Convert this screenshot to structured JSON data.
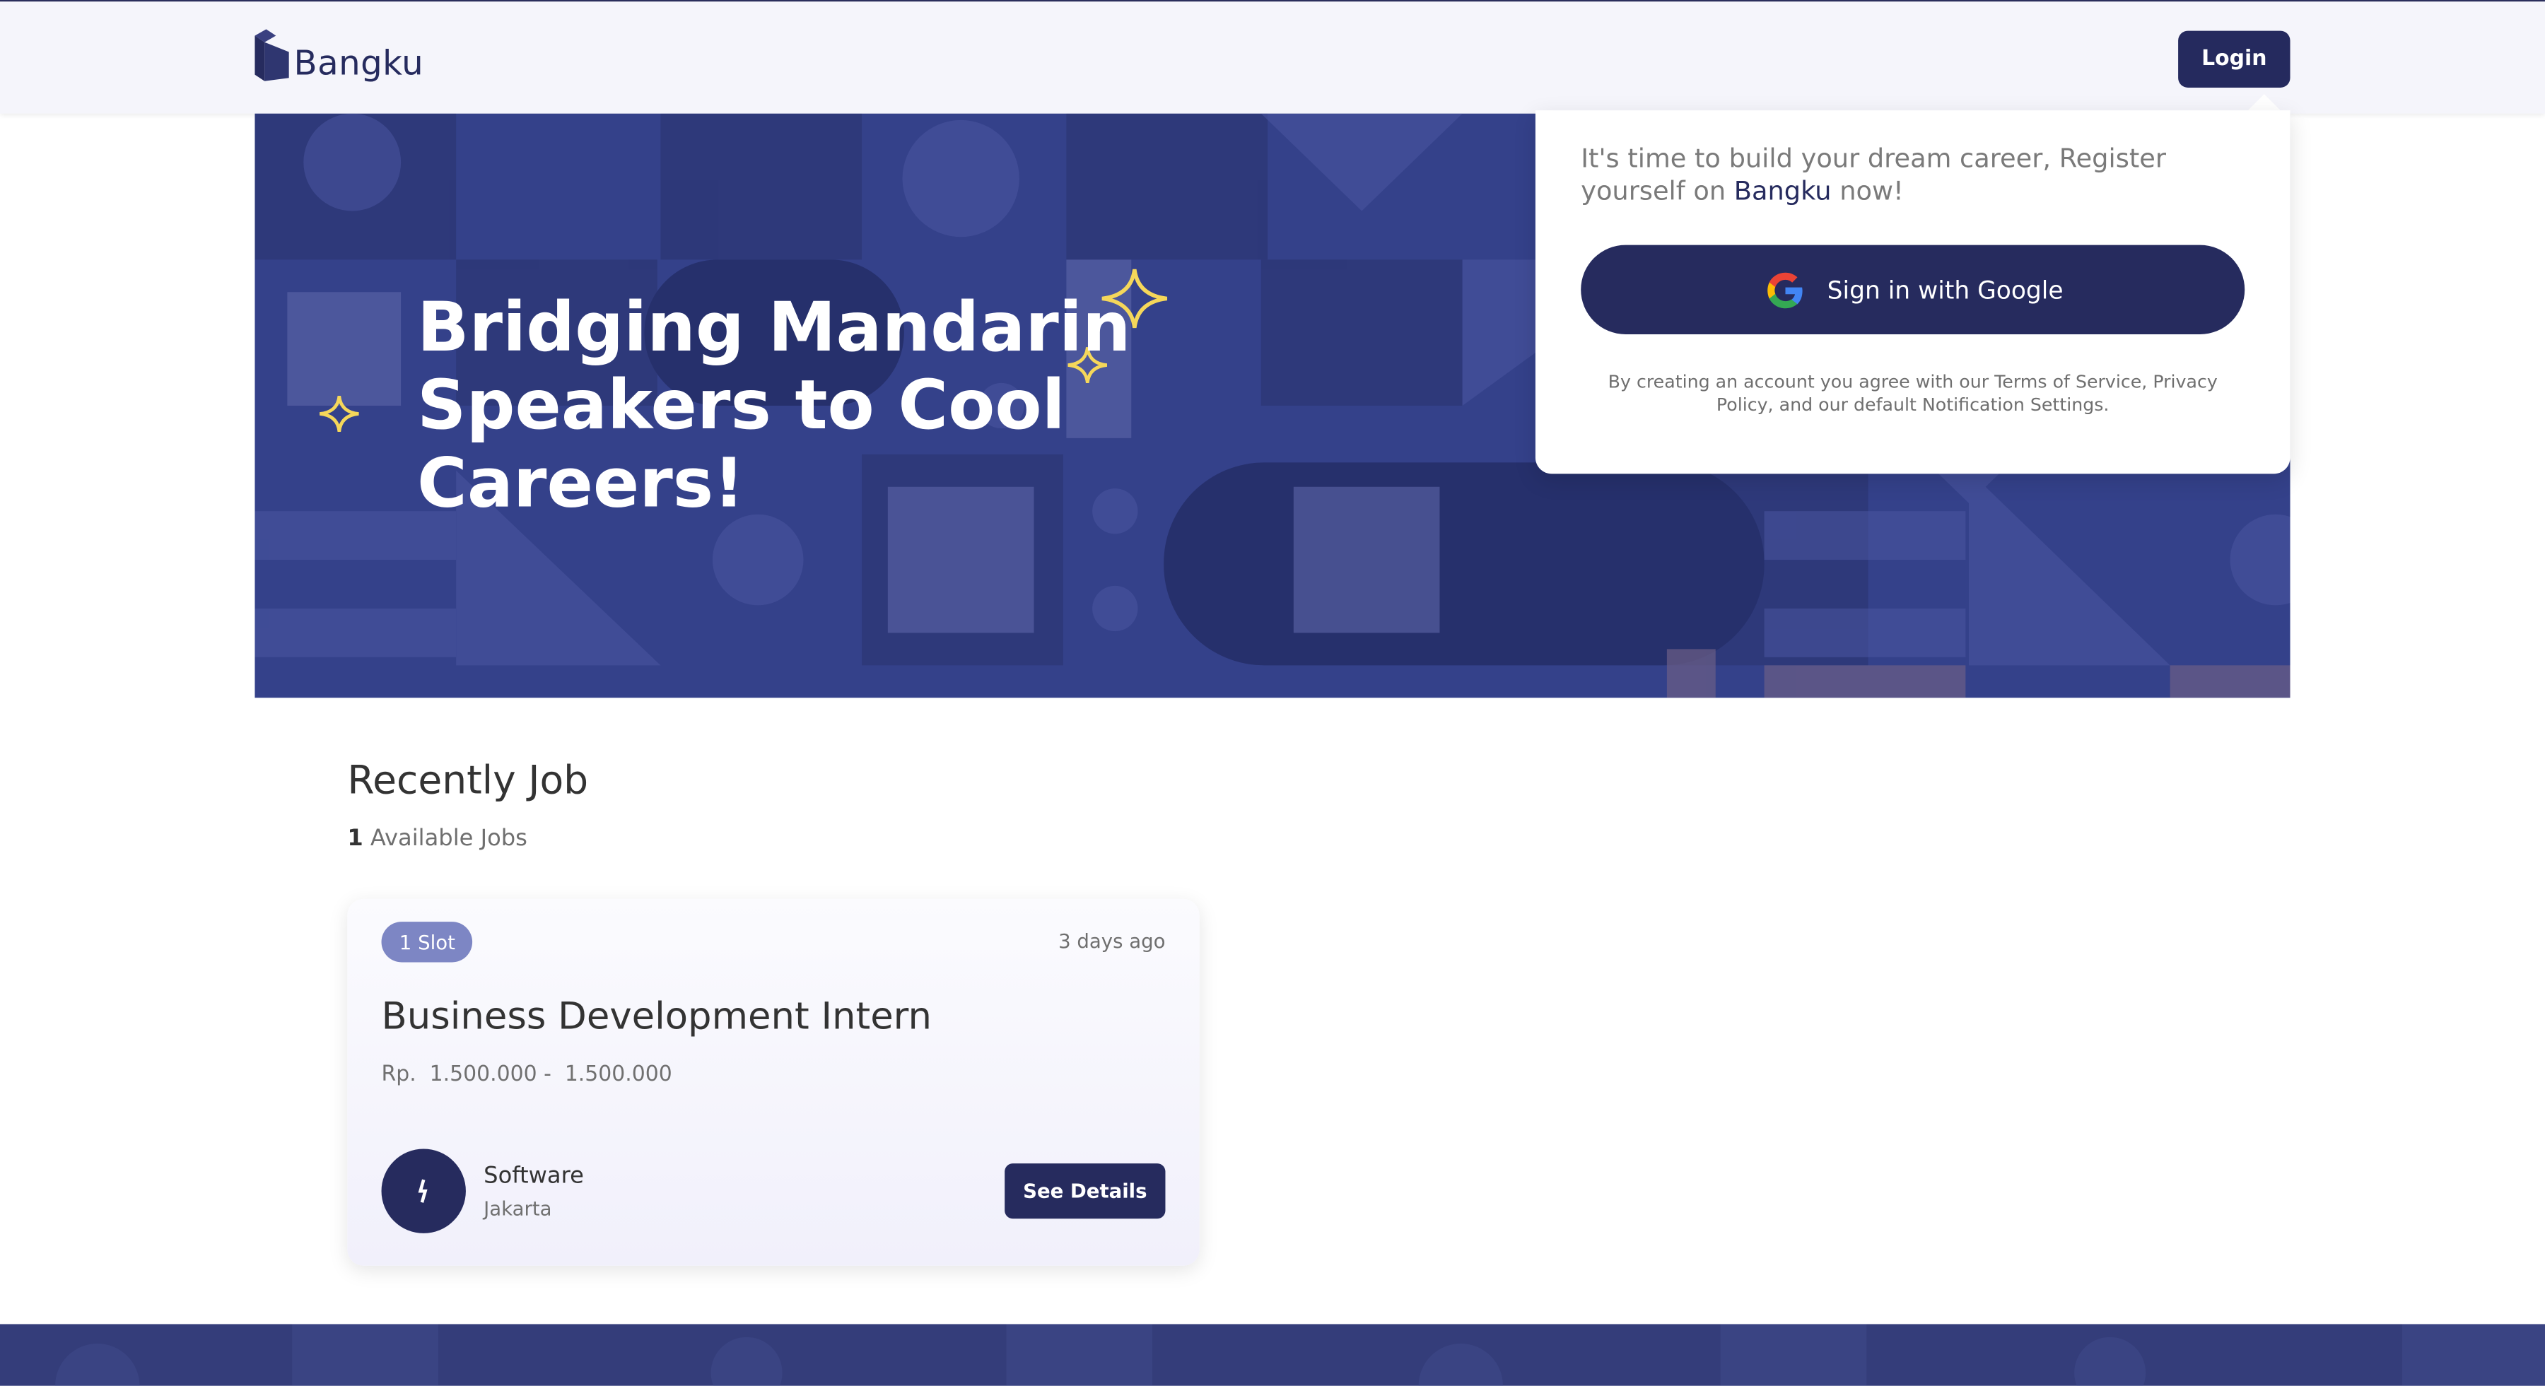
{
  "header": {
    "logo_text": "Bangku",
    "login_label": "Login"
  },
  "hero": {
    "title": "Bridging Mandarin Speakers to Cool Careers!"
  },
  "signup_popup": {
    "prompt_before": "It's time to build your dream career, Register yourself on",
    "prompt_brand": "Bangku",
    "prompt_after": "now!",
    "google_button_label": "Sign in with Google",
    "terms_text": "By creating an account you agree with our Terms of Service, Privacy Policy, and our default Notification Settings."
  },
  "jobs_section": {
    "title": "Recently Job",
    "available_count": "1",
    "available_label": "Available Jobs",
    "jobs": [
      {
        "slot_badge": "1 Slot",
        "posted": "3 days ago",
        "title": "Business Development Intern",
        "salary": "Rp.  1.500.000 -  1.500.000",
        "company_name": "Software",
        "company_location": "Jakarta",
        "details_label": "See Details"
      }
    ]
  },
  "colors": {
    "brand_navy": "#262b5e",
    "hero_blue": "#34418a",
    "badge_purple": "#7d86c4",
    "star_yellow": "#f5d75a"
  },
  "icons": [
    "bangku-logo-icon",
    "google-g-icon",
    "sparkle-star-icon",
    "company-logo-icon"
  ]
}
